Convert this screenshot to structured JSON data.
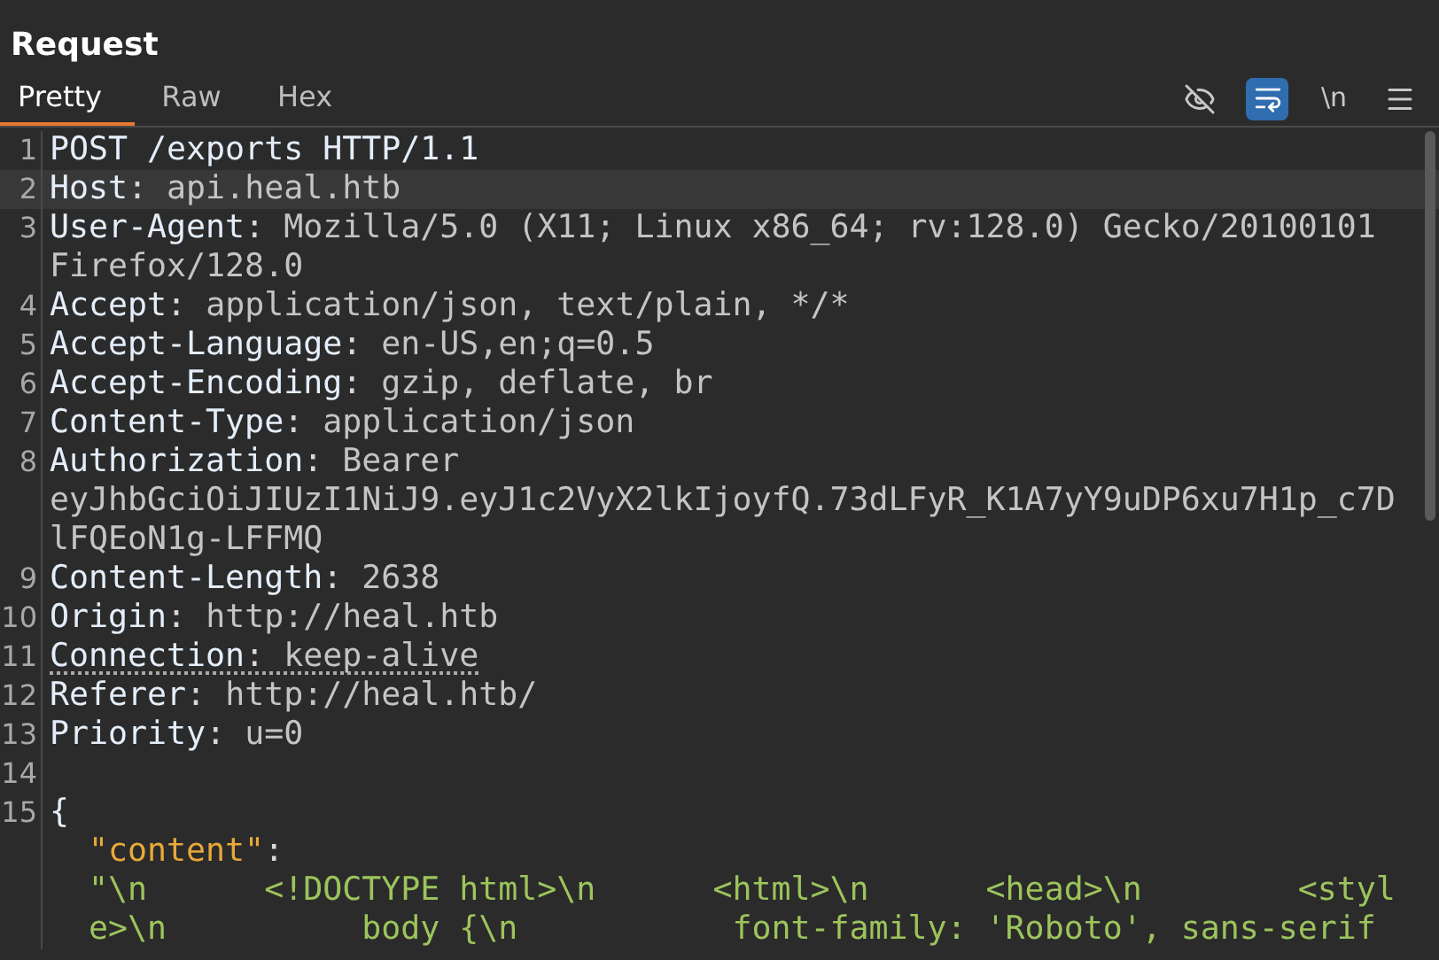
{
  "panel": {
    "title": "Request"
  },
  "tabs": [
    {
      "label": "Pretty",
      "selected": true
    },
    {
      "label": "Raw",
      "selected": false
    },
    {
      "label": "Hex",
      "selected": false
    }
  ],
  "toolbar": [
    {
      "kind": "hide",
      "on": false
    },
    {
      "kind": "wrap",
      "on": true
    },
    {
      "kind": "text",
      "label": "\\n",
      "on": false
    },
    {
      "kind": "menu",
      "on": false
    }
  ],
  "rows": [
    {
      "number": "1",
      "selected": false,
      "underlined": false,
      "segments": [
        {
          "kind": "key",
          "text": "POST /exports HTTP/1.1"
        }
      ]
    },
    {
      "number": "2",
      "selected": true,
      "underlined": false,
      "segments": [
        {
          "kind": "key",
          "text": "Host"
        },
        {
          "kind": "punct",
          "text": ": "
        },
        {
          "kind": "value",
          "text": "api.heal.htb"
        }
      ]
    },
    {
      "number": "3",
      "selected": false,
      "underlined": false,
      "segments": [
        {
          "kind": "key",
          "text": "User-Agent"
        },
        {
          "kind": "punct",
          "text": ": "
        },
        {
          "kind": "value",
          "text": "Mozilla/5.0 (X11; Linux x86_64; rv:128.0) Gecko/20100101"
        }
      ]
    },
    {
      "selected": false,
      "underlined": false,
      "segments": [
        {
          "kind": "value",
          "text": "Firefox/128.0"
        }
      ]
    },
    {
      "number": "4",
      "selected": false,
      "underlined": false,
      "segments": [
        {
          "kind": "key",
          "text": "Accept"
        },
        {
          "kind": "punct",
          "text": ": "
        },
        {
          "kind": "value",
          "text": "application/json, text/plain, */*"
        }
      ]
    },
    {
      "number": "5",
      "selected": false,
      "underlined": false,
      "segments": [
        {
          "kind": "key",
          "text": "Accept-Language"
        },
        {
          "kind": "punct",
          "text": ": "
        },
        {
          "kind": "value",
          "text": "en-US,en;q=0.5"
        }
      ]
    },
    {
      "number": "6",
      "selected": false,
      "underlined": false,
      "segments": [
        {
          "kind": "key",
          "text": "Accept-Encoding"
        },
        {
          "kind": "punct",
          "text": ": "
        },
        {
          "kind": "value",
          "text": "gzip, deflate, br"
        }
      ]
    },
    {
      "number": "7",
      "selected": false,
      "underlined": false,
      "segments": [
        {
          "kind": "key",
          "text": "Content-Type"
        },
        {
          "kind": "punct",
          "text": ": "
        },
        {
          "kind": "value",
          "text": "application/json"
        }
      ]
    },
    {
      "number": "8",
      "selected": false,
      "underlined": false,
      "segments": [
        {
          "kind": "key",
          "text": "Authorization"
        },
        {
          "kind": "punct",
          "text": ": "
        },
        {
          "kind": "value",
          "text": "Bearer"
        }
      ]
    },
    {
      "selected": false,
      "underlined": false,
      "segments": [
        {
          "kind": "value",
          "text": "eyJhbGciOiJIUzI1NiJ9.eyJ1c2VyX2lkIjoyfQ.73dLFyR_K1A7yY9uDP6xu7H1p_c7D"
        }
      ]
    },
    {
      "selected": false,
      "underlined": false,
      "segments": [
        {
          "kind": "value",
          "text": "lFQEoN1g-LFFMQ"
        }
      ]
    },
    {
      "number": "9",
      "selected": false,
      "underlined": false,
      "segments": [
        {
          "kind": "key",
          "text": "Content-Length"
        },
        {
          "kind": "punct",
          "text": ": "
        },
        {
          "kind": "value",
          "text": "2638"
        }
      ]
    },
    {
      "number": "10",
      "selected": false,
      "underlined": false,
      "segments": [
        {
          "kind": "key",
          "text": "Origin"
        },
        {
          "kind": "punct",
          "text": ": "
        },
        {
          "kind": "value",
          "text": "http://heal.htb"
        }
      ]
    },
    {
      "number": "11",
      "selected": false,
      "underlined": true,
      "segments": [
        {
          "kind": "key",
          "text": "Connection"
        },
        {
          "kind": "punct",
          "text": ": "
        },
        {
          "kind": "value",
          "text": "keep-alive"
        }
      ]
    },
    {
      "number": "12",
      "selected": false,
      "underlined": false,
      "segments": [
        {
          "kind": "key",
          "text": "Referer"
        },
        {
          "kind": "punct",
          "text": ": "
        },
        {
          "kind": "value",
          "text": "http://heal.htb/"
        }
      ]
    },
    {
      "number": "13",
      "selected": false,
      "underlined": false,
      "segments": [
        {
          "kind": "key",
          "text": "Priority"
        },
        {
          "kind": "punct",
          "text": ": "
        },
        {
          "kind": "value",
          "text": "u=0"
        }
      ]
    },
    {
      "number": "14",
      "selected": false,
      "underlined": false,
      "segments": []
    },
    {
      "number": "15",
      "selected": false,
      "underlined": false,
      "segments": [
        {
          "kind": "key",
          "text": "{"
        }
      ]
    },
    {
      "selected": false,
      "underlined": false,
      "segments": [
        {
          "kind": "json_key",
          "text": "  \"content\""
        },
        {
          "kind": "punct",
          "text": ":"
        }
      ]
    },
    {
      "selected": false,
      "underlined": false,
      "segments": [
        {
          "kind": "json_string",
          "text": "  \"\\n      <!DOCTYPE html>\\n      <html>\\n      <head>\\n        <styl"
        }
      ]
    },
    {
      "selected": false,
      "underlined": false,
      "segments": [
        {
          "kind": "json_string",
          "text": "  e>\\n          body {\\n           font-family: 'Roboto', sans-serif"
        }
      ]
    }
  ]
}
